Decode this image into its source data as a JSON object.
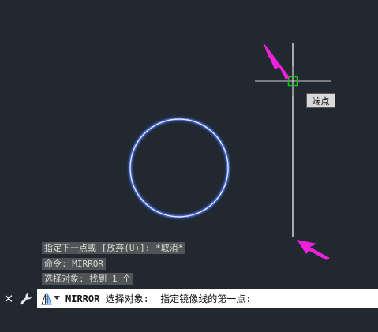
{
  "viewport": {
    "background": "#212830",
    "tooltip": "端点"
  },
  "history": [
    "指定下一点或 [放弃(U)]: *取消*",
    "命令: MIRROR",
    "选择对象: 找到 1 个"
  ],
  "command_line": {
    "close_icon": "close-icon",
    "customize_icon": "wrench-icon",
    "command_icon": "mirror-icon",
    "command_name": "MIRROR",
    "prompt": " 选择对象:  指定镜像线的第一点:"
  },
  "colors": {
    "circle": "#dfe6ff",
    "circle_glow": "#4f78ff",
    "line": "#ffffff",
    "snap_marker": "#19c219",
    "arrow": "#ee22dd"
  }
}
